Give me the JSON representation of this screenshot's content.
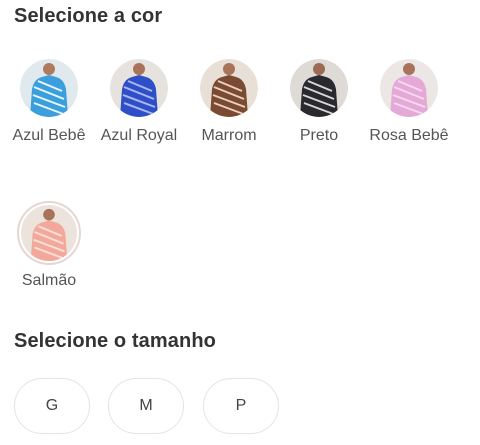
{
  "color_section": {
    "title": "Selecione a cor",
    "options": [
      {
        "label": "Azul Bebê",
        "bg": "#dfe9ee",
        "shirt": "#3a9fdc",
        "stripe": "#e9f6ff"
      },
      {
        "label": "Azul Royal",
        "bg": "#e6e3df",
        "shirt": "#2f4fc8",
        "stripe": "#aab8f2"
      },
      {
        "label": "Marrom",
        "bg": "#e8dfd6",
        "shirt": "#7a4a33",
        "stripe": "#e9d0bb"
      },
      {
        "label": "Preto",
        "bg": "#dedad6",
        "shirt": "#2a2a2e",
        "stripe": "#d6d6d6"
      },
      {
        "label": "Rosa Bebê",
        "bg": "#ece7e5",
        "shirt": "#e4a9d6",
        "stripe": "#f7d9ef"
      },
      {
        "label": "Salmão",
        "bg": "#ebe3dc",
        "shirt": "#f2a99c",
        "stripe": "#fbe0da"
      }
    ],
    "selected": "Salmão"
  },
  "size_section": {
    "title": "Selecione o tamanho",
    "sizes": [
      "G",
      "M",
      "P"
    ]
  }
}
